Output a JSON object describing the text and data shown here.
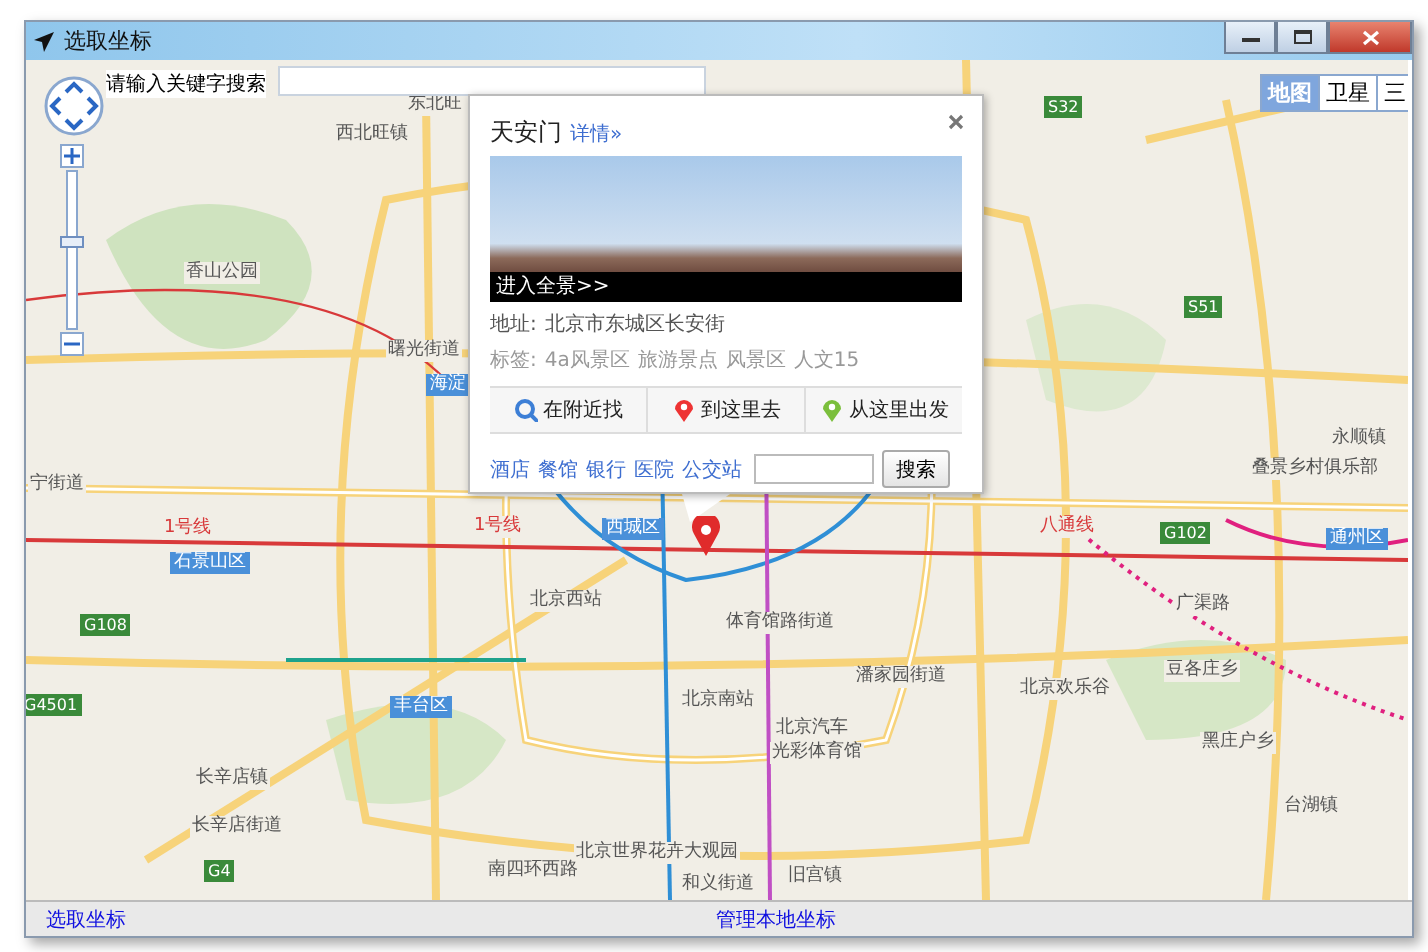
{
  "window": {
    "title": "选取坐标"
  },
  "search": {
    "label": "请输入关键字搜索"
  },
  "zoom_slider": {
    "level": 0.56
  },
  "map_types": [
    {
      "label": "地图",
      "selected": true
    },
    {
      "label": "卫星",
      "selected": false
    },
    {
      "label": "三",
      "selected": false
    }
  ],
  "map_labels": [
    {
      "text": "东北旺",
      "kind": "place"
    },
    {
      "text": "西北旺镇",
      "kind": "place"
    },
    {
      "text": "香山公园",
      "kind": "place"
    },
    {
      "text": "曙光街道",
      "kind": "place"
    },
    {
      "text": "海淀",
      "kind": "district"
    },
    {
      "text": "宁街道",
      "kind": "place"
    },
    {
      "text": "1号线",
      "kind": "line"
    },
    {
      "text": "石景山区",
      "kind": "district"
    },
    {
      "text": "1号线",
      "kind": "line"
    },
    {
      "text": "西城区",
      "kind": "district"
    },
    {
      "text": "北京西站",
      "kind": "place"
    },
    {
      "text": "体育馆路街道",
      "kind": "place"
    },
    {
      "text": "广渠路",
      "kind": "place"
    },
    {
      "text": "G102",
      "kind": "highway"
    },
    {
      "text": "S51",
      "kind": "highway"
    },
    {
      "text": "S32",
      "kind": "highway"
    },
    {
      "text": "潘家园街道",
      "kind": "place"
    },
    {
      "text": "北京欢乐谷",
      "kind": "place"
    },
    {
      "text": "丰台区",
      "kind": "district"
    },
    {
      "text": "北京南站",
      "kind": "place"
    },
    {
      "text": "北京汽车",
      "kind": "place"
    },
    {
      "text": "光彩体育馆",
      "kind": "place"
    },
    {
      "text": "北京世界花卉大观园",
      "kind": "place"
    },
    {
      "text": "长辛店镇",
      "kind": "place"
    },
    {
      "text": "长辛店街道",
      "kind": "place"
    },
    {
      "text": "南四环西路",
      "kind": "place"
    },
    {
      "text": "和义街道",
      "kind": "place"
    },
    {
      "text": "旧宫镇",
      "kind": "place"
    },
    {
      "text": "黑庄户乡",
      "kind": "place"
    },
    {
      "text": "台湖镇",
      "kind": "place"
    },
    {
      "text": "豆各庄乡",
      "kind": "place"
    },
    {
      "text": "叠景乡村俱乐部",
      "kind": "place"
    },
    {
      "text": "永顺镇",
      "kind": "place"
    },
    {
      "text": "通州区",
      "kind": "district"
    },
    {
      "text": "G108",
      "kind": "highway"
    },
    {
      "text": "G4501",
      "kind": "highway"
    },
    {
      "text": "G4",
      "kind": "highway"
    },
    {
      "text": "八通线",
      "kind": "line"
    }
  ],
  "popup": {
    "title": "天安门",
    "detail_link": "详情»",
    "panorama_link": "进入全景>>",
    "address_label": "地址:",
    "address": "北京市东城区长安街",
    "tags_label": "标签:",
    "tags": [
      "4a风景区",
      "旅游景点",
      "风景区",
      "人文15"
    ],
    "actions": [
      {
        "label": "在附近找",
        "kind": "search"
      },
      {
        "label": "到这里去",
        "kind": "to"
      },
      {
        "label": "从这里出发",
        "kind": "from"
      }
    ],
    "categories": [
      "酒店",
      "餐馆",
      "银行",
      "医院",
      "公交站"
    ],
    "search_button": "搜索"
  },
  "status_bar": {
    "links": [
      "选取坐标",
      "管理本地坐标"
    ]
  }
}
